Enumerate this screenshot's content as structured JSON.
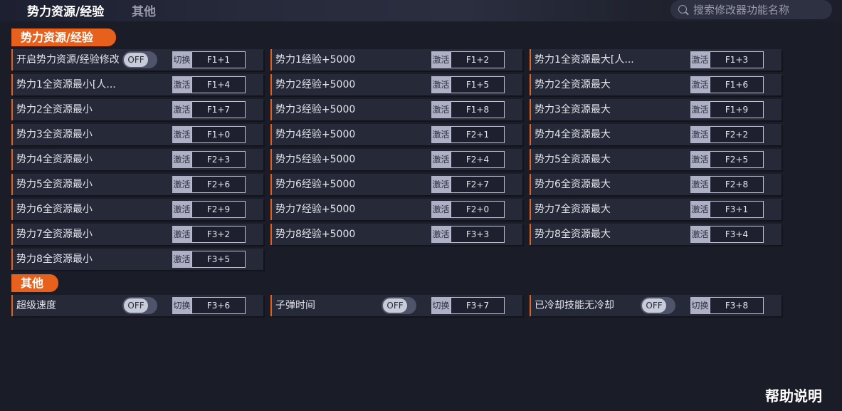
{
  "tabs": [
    "势力资源/经验",
    "其他"
  ],
  "search": {
    "placeholder": "搜索修改器功能名称"
  },
  "sections": [
    {
      "title": "势力资源/经验",
      "items": [
        {
          "label": "开启势力资源/经验修改",
          "toggle": "OFF",
          "action": "切换",
          "key": "F1+1"
        },
        {
          "label": "势力1经验+5000",
          "action": "激活",
          "key": "F1+2"
        },
        {
          "label": "势力1全资源最大[人...",
          "action": "激活",
          "key": "F1+3"
        },
        {
          "label": "势力1全资源最小[人...",
          "action": "激活",
          "key": "F1+4"
        },
        {
          "label": "势力2经验+5000",
          "action": "激活",
          "key": "F1+5"
        },
        {
          "label": "势力2全资源最大",
          "action": "激活",
          "key": "F1+6"
        },
        {
          "label": "势力2全资源最小",
          "action": "激活",
          "key": "F1+7"
        },
        {
          "label": "势力3经验+5000",
          "action": "激活",
          "key": "F1+8"
        },
        {
          "label": "势力3全资源最大",
          "action": "激活",
          "key": "F1+9"
        },
        {
          "label": "势力3全资源最小",
          "action": "激活",
          "key": "F1+0"
        },
        {
          "label": "势力4经验+5000",
          "action": "激活",
          "key": "F2+1"
        },
        {
          "label": "势力4全资源最大",
          "action": "激活",
          "key": "F2+2"
        },
        {
          "label": "势力4全资源最小",
          "action": "激活",
          "key": "F2+3"
        },
        {
          "label": "势力5经验+5000",
          "action": "激活",
          "key": "F2+4"
        },
        {
          "label": "势力5全资源最大",
          "action": "激活",
          "key": "F2+5"
        },
        {
          "label": "势力5全资源最小",
          "action": "激活",
          "key": "F2+6"
        },
        {
          "label": "势力6经验+5000",
          "action": "激活",
          "key": "F2+7"
        },
        {
          "label": "势力6全资源最大",
          "action": "激活",
          "key": "F2+8"
        },
        {
          "label": "势力6全资源最小",
          "action": "激活",
          "key": "F2+9"
        },
        {
          "label": "势力7经验+5000",
          "action": "激活",
          "key": "F2+0"
        },
        {
          "label": "势力7全资源最大",
          "action": "激活",
          "key": "F3+1"
        },
        {
          "label": "势力7全资源最小",
          "action": "激活",
          "key": "F3+2"
        },
        {
          "label": "势力8经验+5000",
          "action": "激活",
          "key": "F3+3"
        },
        {
          "label": "势力8全资源最大",
          "action": "激活",
          "key": "F3+4"
        },
        {
          "label": "势力8全资源最小",
          "action": "激活",
          "key": "F3+5"
        }
      ]
    },
    {
      "title": "其他",
      "items": [
        {
          "label": "超级速度",
          "toggle": "OFF",
          "action": "切换",
          "key": "F3+6"
        },
        {
          "label": "子弹时间",
          "toggle": "OFF",
          "action": "切换",
          "key": "F3+7"
        },
        {
          "label": "已冷却技能无冷却",
          "toggle": "OFF",
          "action": "切换",
          "key": "F3+8"
        }
      ]
    }
  ],
  "help": "帮助说明",
  "colors": {
    "accent": "#e8611c",
    "background": "#1a1c28",
    "row": "#262938"
  }
}
